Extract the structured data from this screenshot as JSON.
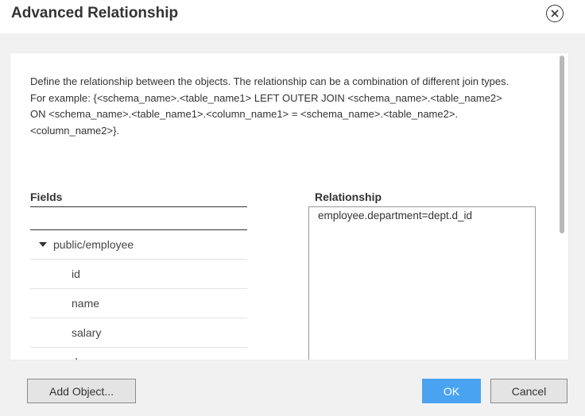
{
  "dialog": {
    "title": "Advanced Relationship",
    "close_icon": "close-circle-icon"
  },
  "description": {
    "line1": "Define the relationship between the objects. The relationship can be a combination of different join types.",
    "line2": "For example: {<schema_name>.<table_name1> LEFT OUTER JOIN <schema_name>.<table_name2> ON <schema_name>.<table_name1>.<column_name1> = <schema_name>.<table_name2>.<column_name2>}."
  },
  "fields": {
    "header": "Fields",
    "parent": "public/employee",
    "children": [
      "id",
      "name",
      "salary",
      "d"
    ]
  },
  "relationship": {
    "header": "Relationship",
    "value": "employee.department=dept.d_id"
  },
  "footer": {
    "add_object_label": "Add Object...",
    "ok_label": "OK",
    "cancel_label": "Cancel"
  },
  "colors": {
    "primary": "#4aa3f0",
    "background": "#f1f1f1"
  }
}
